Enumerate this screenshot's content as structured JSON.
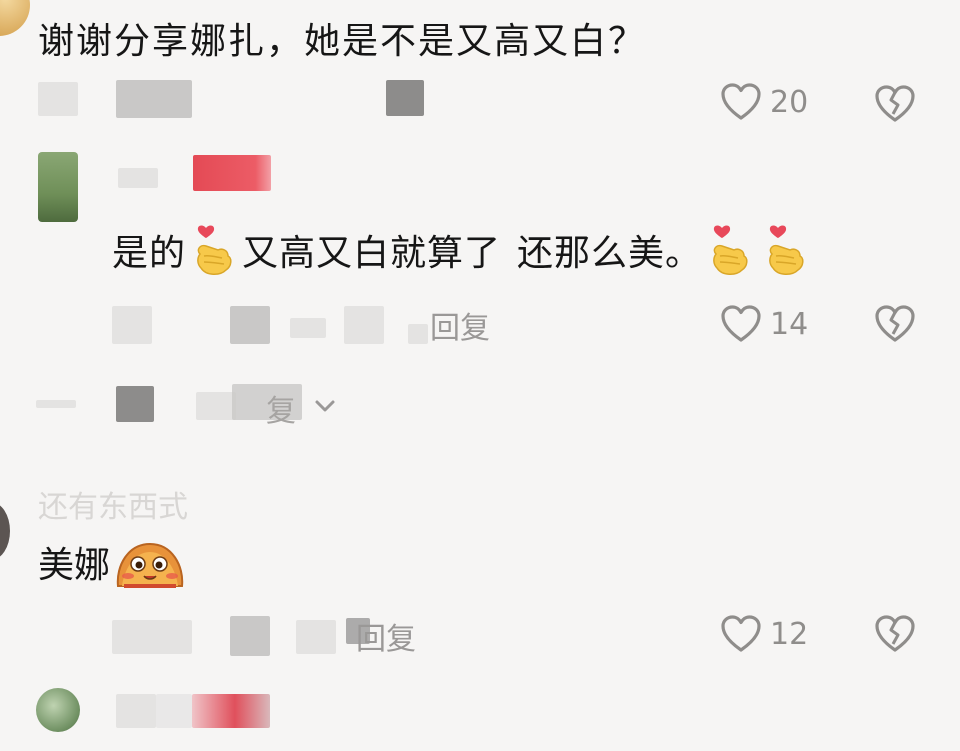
{
  "comments": [
    {
      "text": "谢谢分享娜扎，她是不是又高又白？",
      "likes": "20"
    },
    {
      "reply": {
        "text_part1": "是的",
        "text_part2": "又高又白就算了",
        "text_part3": "还那么美。",
        "emoji": "finger-heart-emoji",
        "reply_label": "回复",
        "likes": "14"
      },
      "expand_label": "复"
    },
    {
      "faint_text": "还有东西式",
      "text": "美娜",
      "emoji": "blushing-blob-emoji",
      "reply_label": "回复",
      "likes": "12"
    }
  ],
  "colors": {
    "background": "#f6f5f4",
    "text": "#161616",
    "meta": "#9a9897",
    "icon": "#8f8d8b",
    "name_red": "#e44a55"
  },
  "icons": [
    "heart-icon",
    "broken-heart-icon",
    "chevron-down-icon"
  ]
}
